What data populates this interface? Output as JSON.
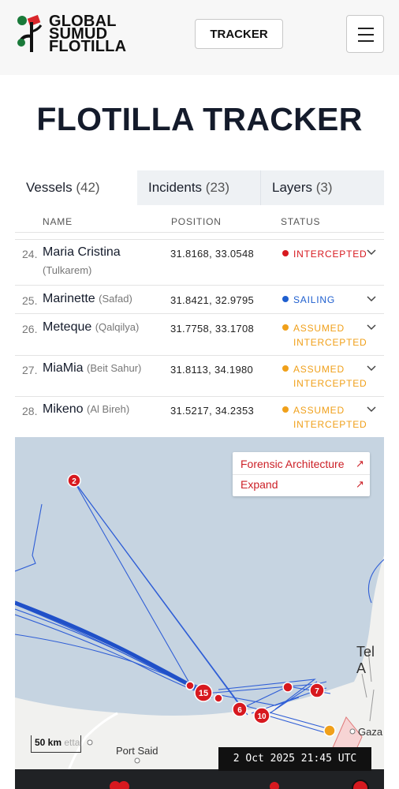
{
  "header": {
    "logo_lines": [
      "GLOBAL",
      "SUMUD",
      "FLOTILLA"
    ],
    "tracker_label": "TRACKER",
    "menu_icon": "hamburger-icon"
  },
  "page_title": "FLOTILLA TRACKER",
  "tabs": [
    {
      "label": "Vessels",
      "count": "(42)",
      "active": true
    },
    {
      "label": "Incidents",
      "count": "(23)",
      "active": false
    },
    {
      "label": "Layers",
      "count": "(3)",
      "active": false
    }
  ],
  "columns": {
    "name": "NAME",
    "position": "POSITION",
    "status": "STATUS"
  },
  "vessels": [
    {
      "num": "24.",
      "name": "Maria Cristina",
      "origin": "(Tulkarem)",
      "position": "31.8168, 33.0548",
      "status": "INTERCEPTED",
      "status_color": "#d7191f"
    },
    {
      "num": "25.",
      "name": "Marinette",
      "origin": "(Safad)",
      "position": "31.8421, 32.9795",
      "status": "SAILING",
      "status_color": "#1f5fcf"
    },
    {
      "num": "26.",
      "name": "Meteque",
      "origin": "(Qalqilya)",
      "position": "31.7758, 33.1708",
      "status": "ASSUMED INTERCEPTED",
      "status_line1": "ASSUMED",
      "status_line2": "INTERCEPTED",
      "status_color": "#f0a01a"
    },
    {
      "num": "27.",
      "name": "MiaMia",
      "origin": "(Beit Sahur)",
      "position": "31.8113, 34.1980",
      "status": "ASSUMED INTERCEPTED",
      "status_line1": "ASSUMED",
      "status_line2": "INTERCEPTED",
      "status_color": "#f0a01a"
    },
    {
      "num": "28.",
      "name": "Mikeno",
      "origin": "(Al Bireh)",
      "position": "31.5217, 34.2353",
      "status": "ASSUMED INTERCEPTED",
      "status_line1": "ASSUMED",
      "status_line2": "INTERCEPTED",
      "status_color": "#f0a01a"
    }
  ],
  "map": {
    "links": [
      {
        "label": "Forensic Architecture",
        "icon": "external-arrow-icon"
      },
      {
        "label": "Expand",
        "icon": "external-arrow-icon"
      }
    ],
    "cluster_labels": [
      "2",
      "15",
      "6",
      "10",
      "7"
    ],
    "places": [
      "Tel A",
      "Gaza",
      "Port Said"
    ],
    "scale_label": "50 km",
    "scale_faint": "etta",
    "timestamp": "2 Oct 2025 21:45 UTC",
    "route_color": "#2f5ed6",
    "marker_color": "#d7191f",
    "accent_orange": "#f0a01a"
  }
}
